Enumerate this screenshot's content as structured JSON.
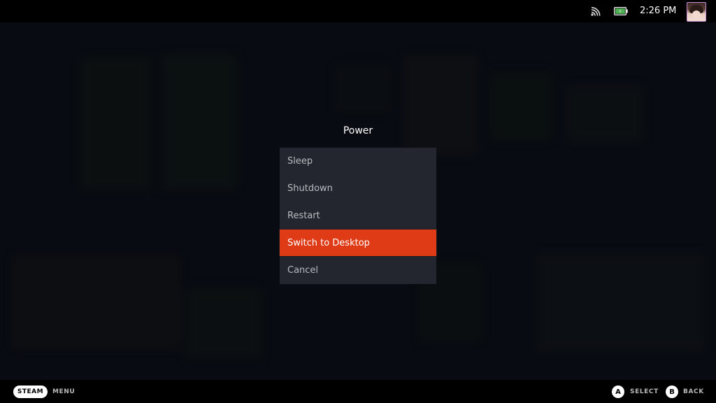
{
  "status_bar": {
    "wifi_icon": "wifi-icon",
    "battery_icon": "battery-charging-icon",
    "battery_color": "#4caf50",
    "time": "2:26 PM",
    "avatar": "user-avatar"
  },
  "dialog": {
    "title": "Power",
    "items": [
      {
        "label": "Sleep",
        "selected": false
      },
      {
        "label": "Shutdown",
        "selected": false
      },
      {
        "label": "Restart",
        "selected": false
      },
      {
        "label": "Switch to Desktop",
        "selected": true
      },
      {
        "label": "Cancel",
        "selected": false
      }
    ],
    "accent_color": "#de3b16"
  },
  "bottom_bar": {
    "steam_label": "STEAM",
    "menu_label": "MENU",
    "a_button": "A",
    "select_label": "SELECT",
    "b_button": "B",
    "back_label": "BACK"
  }
}
